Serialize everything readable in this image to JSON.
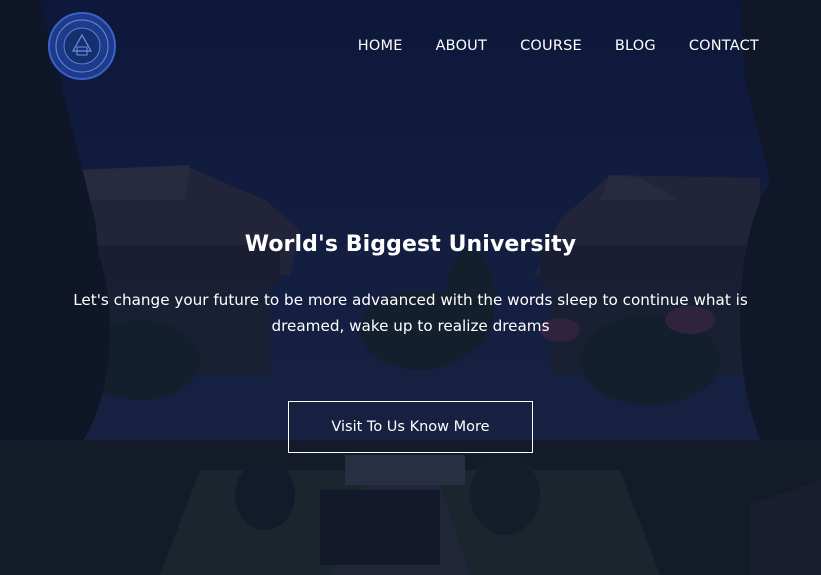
{
  "nav": {
    "logo": "university-seal-logo",
    "items": [
      {
        "label": "HOME"
      },
      {
        "label": "ABOUT"
      },
      {
        "label": "COURSE"
      },
      {
        "label": "BLOG"
      },
      {
        "label": "CONTACT"
      }
    ]
  },
  "hero": {
    "title": "World's Biggest University",
    "subtitle": "Let's change your future to be more advaanced with the words sleep to continue what is dreamed, wake up to realize dreams",
    "cta_label": "Visit To Us Know More"
  },
  "colors": {
    "overlay": "#0c1432",
    "text": "#ffffff",
    "logo_blue": "#2a4fb0"
  }
}
